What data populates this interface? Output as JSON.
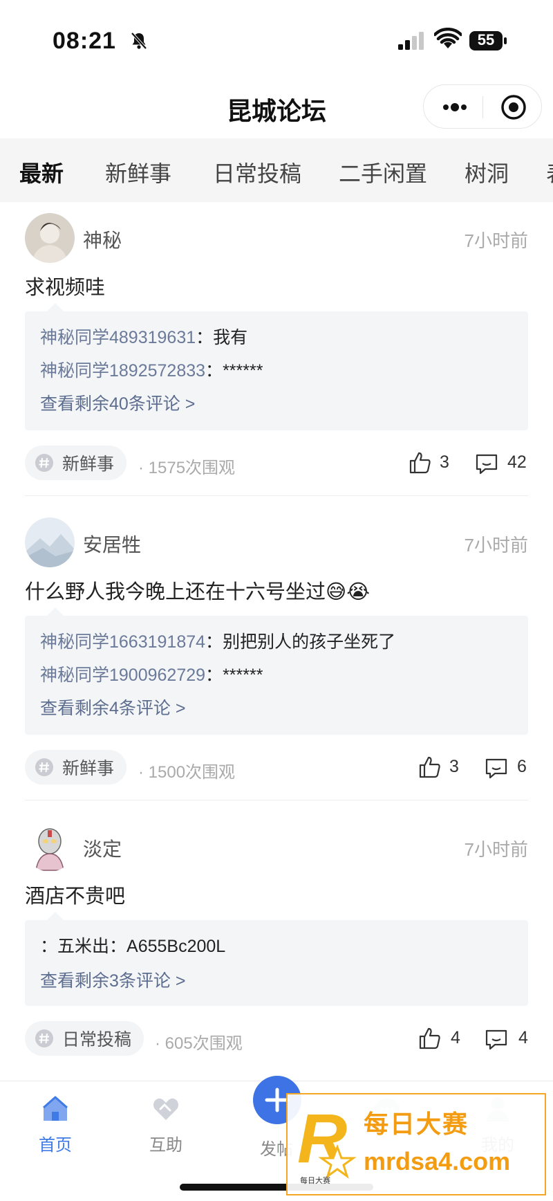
{
  "status_bar": {
    "time": "08:21",
    "battery": "55"
  },
  "nav": {
    "title": "昆城论坛"
  },
  "tabs": [
    {
      "label": "最新",
      "active": true
    },
    {
      "label": "新鲜事",
      "active": false
    },
    {
      "label": "日常投稿",
      "active": false
    },
    {
      "label": "二手闲置",
      "active": false
    },
    {
      "label": "树洞",
      "active": false
    },
    {
      "label": "表",
      "active": false
    }
  ],
  "posts": [
    {
      "author": "神秘",
      "time": "7小时前",
      "content": "求视频哇",
      "comments": [
        {
          "name": "神秘同学489319631",
          "sep": "：",
          "text": "我有"
        },
        {
          "name": "神秘同学1892572833",
          "sep": "：",
          "text": "******"
        }
      ],
      "more_comments": "查看剩余40条评论 >",
      "tag": "新鲜事",
      "views": "· 1575次围观",
      "likes": "3",
      "comment_count": "42"
    },
    {
      "author": "安居牲",
      "time": "7小时前",
      "content": "什么野人我今晚上还在十六号坐过😅😭",
      "comments": [
        {
          "name": "神秘同学1663191874",
          "sep": "：",
          "text": "别把别人的孩子坐死了"
        },
        {
          "name": "神秘同学1900962729",
          "sep": "：",
          "text": "******"
        }
      ],
      "more_comments": "查看剩余4条评论 >",
      "tag": "新鲜事",
      "views": "· 1500次围观",
      "likes": "3",
      "comment_count": "6"
    },
    {
      "author": "淡定",
      "time": "7小时前",
      "content": "酒店不贵吧",
      "comments": [
        {
          "name": "",
          "sep": "：",
          "text": "五米出：A655Bc200L"
        }
      ],
      "more_comments": "查看剩余3条评论 >",
      "tag": "日常投稿",
      "views": "· 605次围观",
      "likes": "4",
      "comment_count": "4"
    }
  ],
  "bottom_nav": {
    "home": "首页",
    "help": "互助",
    "post": "发帖",
    "mine": "我的"
  },
  "watermark": {
    "title": "每日大赛",
    "url": "mrdsa4.com",
    "small": "每日大赛"
  },
  "colors": {
    "accent": "#3d73e4",
    "link": "#5d6d8f",
    "watermark": "#f39c12"
  },
  "icons": {
    "like": "thumbs-up-icon",
    "comment": "comment-icon",
    "tag": "hash-icon",
    "home": "home-icon",
    "help": "handshake-icon",
    "post": "plus-icon",
    "mine": "user-icon"
  }
}
